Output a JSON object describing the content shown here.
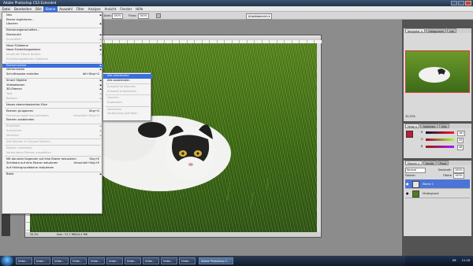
{
  "window": {
    "title": "Adobe Photoshop CS3 Extended"
  },
  "menubar": {
    "items": [
      "Datei",
      "Bearbeiten",
      "Bild",
      "Ebene",
      "Auswahl",
      "Filter",
      "Analyse",
      "Ansicht",
      "Fenster",
      "Hilfe"
    ],
    "active": "Ebene"
  },
  "options": {
    "zoom_label": "Abst.:",
    "zoom_value": "100%",
    "flow_label": "Fluss:",
    "flow_value": "100%",
    "workspace_button": "Arbeitsbereich"
  },
  "layer_menu": {
    "items": [
      {
        "label": "Neu",
        "shortcut": "",
        "submenu": true,
        "disabled": false
      },
      {
        "label": "Ebene duplizieren...",
        "shortcut": "",
        "submenu": false,
        "disabled": false
      },
      {
        "label": "Löschen",
        "shortcut": "",
        "submenu": true,
        "disabled": false
      },
      {
        "label": "Ebeneneigenschaften...",
        "shortcut": "",
        "submenu": false,
        "disabled": false
      },
      {
        "label": "Ebenenstil",
        "shortcut": "",
        "submenu": true,
        "disabled": false
      },
      {
        "label": "Smartfilter",
        "shortcut": "",
        "submenu": true,
        "disabled": true
      },
      {
        "label": "Neue Füllebene",
        "shortcut": "",
        "submenu": true,
        "disabled": false
      },
      {
        "label": "Neue Einstellungsebene",
        "shortcut": "",
        "submenu": true,
        "disabled": false
      },
      {
        "label": "Inhalt der Ebene ändern",
        "shortcut": "",
        "submenu": true,
        "disabled": true
      },
      {
        "label": "Einstellungsebenen-Optionen",
        "shortcut": "",
        "submenu": false,
        "disabled": true
      },
      {
        "label": "Ebenenmaske",
        "shortcut": "",
        "submenu": true,
        "disabled": false,
        "highlight": true
      },
      {
        "label": "Vektormaske",
        "shortcut": "",
        "submenu": true,
        "disabled": false
      },
      {
        "label": "Schnittmaske erstellen",
        "shortcut": "Alt+Strg+G",
        "submenu": false,
        "disabled": false
      },
      {
        "label": "Smart Objekte",
        "shortcut": "",
        "submenu": true,
        "disabled": false
      },
      {
        "label": "Videoebenen",
        "shortcut": "",
        "submenu": true,
        "disabled": false
      },
      {
        "label": "3D-Ebenen",
        "shortcut": "",
        "submenu": true,
        "disabled": false
      },
      {
        "label": "Text",
        "shortcut": "",
        "submenu": true,
        "disabled": true
      },
      {
        "label": "Rastern",
        "shortcut": "",
        "submenu": true,
        "disabled": true
      },
      {
        "label": "Neues ebenenbasiertes Slice",
        "shortcut": "",
        "submenu": false,
        "disabled": false
      },
      {
        "label": "Ebenen gruppieren",
        "shortcut": "Strg+G",
        "submenu": false,
        "disabled": false
      },
      {
        "label": "Ebenengruppierung aufheben",
        "shortcut": "Umschalt+Strg+G",
        "submenu": false,
        "disabled": true
      },
      {
        "label": "Ebenen ausblenden",
        "shortcut": "",
        "submenu": false,
        "disabled": false
      },
      {
        "label": "Anordnen",
        "shortcut": "",
        "submenu": true,
        "disabled": true
      },
      {
        "label": "Ausrichten",
        "shortcut": "",
        "submenu": true,
        "disabled": true
      },
      {
        "label": "Verteilen",
        "shortcut": "",
        "submenu": true,
        "disabled": true
      },
      {
        "label": "Alle Ebenen in Gruppe fixieren...",
        "shortcut": "",
        "submenu": false,
        "disabled": true
      },
      {
        "label": "Ebenen verbinden",
        "shortcut": "",
        "submenu": false,
        "disabled": true
      },
      {
        "label": "Verbundene Ebenen auswählen",
        "shortcut": "",
        "submenu": false,
        "disabled": true
      },
      {
        "label": "Mit darunter liegender auf eine Ebene reduzieren",
        "shortcut": "Strg+E",
        "submenu": false,
        "disabled": false
      },
      {
        "label": "Sichtbare auf eine Ebene reduzieren",
        "shortcut": "Umschalt+Strg+E",
        "submenu": false,
        "disabled": false
      },
      {
        "label": "Auf Hintergrundebene reduzieren",
        "shortcut": "",
        "submenu": false,
        "disabled": false
      },
      {
        "label": "Basis",
        "shortcut": "",
        "submenu": true,
        "disabled": false
      }
    ]
  },
  "mask_submenu": {
    "items": [
      {
        "label": "Alle einblenden",
        "disabled": false,
        "highlight": true
      },
      {
        "label": "Alle ausblenden",
        "disabled": false
      },
      {
        "label": "Auswahl einblenden",
        "disabled": true
      },
      {
        "label": "Auswahl ausblenden",
        "disabled": true
      },
      {
        "label": "Löschen",
        "disabled": true
      },
      {
        "label": "Anwenden",
        "disabled": true
      },
      {
        "label": "Aktivieren",
        "disabled": true
      },
      {
        "label": "Verbindung aufheben",
        "disabled": true
      }
    ]
  },
  "document": {
    "zoom": "33,3%",
    "info": "Dok.: 37,1 MB/24,4 MB"
  },
  "navigator": {
    "tabs": [
      "Navigator ×",
      "Histogramm",
      "Info"
    ],
    "zoom": "33,33%"
  },
  "color_panel": {
    "tabs": [
      "Farbe ×",
      "Farbfelder",
      "Stile"
    ],
    "channels": [
      {
        "name": "R",
        "value": "161"
      },
      {
        "name": "G",
        "value": "25"
      },
      {
        "name": "B",
        "value": "48"
      }
    ],
    "accent": "#c8183a"
  },
  "layers_panel": {
    "tabs": [
      "Ebenen ×",
      "Kanäle",
      "Pfade"
    ],
    "mode": "Normal",
    "opacity_label": "Deckkraft:",
    "opacity_value": "100%",
    "lock_label": "Fixieren:",
    "fill_label": "Fläche:",
    "fill_value": "100%",
    "layers": [
      {
        "name": "Ebene 1",
        "selected": true
      },
      {
        "name": "Hintergrund",
        "selected": false
      }
    ]
  },
  "taskbar": {
    "buttons": [
      "Unbe...",
      "Unbe...",
      "Unbe...",
      "Unbe...",
      "Unbe...",
      "Unbe...",
      "Unbe...",
      "Unbe...",
      "Unbe...",
      "Unbe..."
    ],
    "active_app": "Adobe Photoshop C...",
    "lang": "DE",
    "time": "11:18"
  }
}
